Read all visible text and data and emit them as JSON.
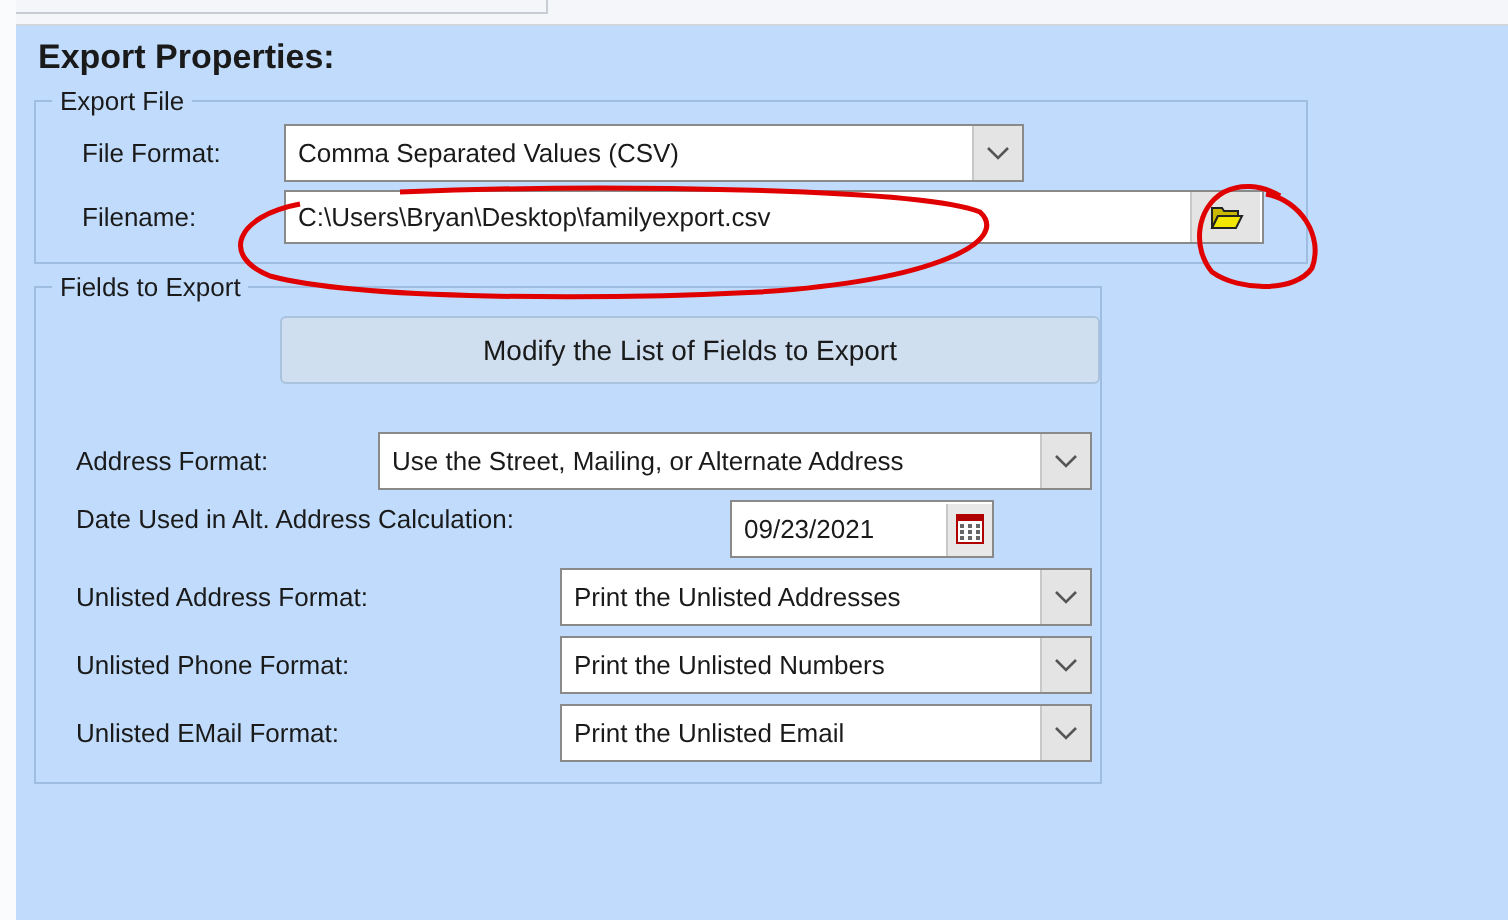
{
  "title": "Export Properties:",
  "export_file": {
    "legend": "Export File",
    "file_format": {
      "label": "File Format:",
      "value": "Comma Separated Values (CSV)"
    },
    "filename": {
      "label": "Filename:",
      "value": "C:\\Users\\Bryan\\Desktop\\familyexport.csv"
    }
  },
  "fields_to_export": {
    "legend": "Fields to Export",
    "modify_button": "Modify the List of Fields to Export",
    "address_format": {
      "label": "Address Format:",
      "value": "Use the Street, Mailing, or Alternate Address"
    },
    "date": {
      "label": "Date Used in Alt. Address Calculation:",
      "value": "09/23/2021"
    },
    "unlisted": [
      {
        "label": "Unlisted Address Format:",
        "value": "Print the Unlisted Addresses"
      },
      {
        "label": "Unlisted Phone Format:",
        "value": "Print the Unlisted Numbers"
      },
      {
        "label": "Unlisted EMail Format:",
        "value": "Print the Unlisted Email"
      }
    ]
  }
}
